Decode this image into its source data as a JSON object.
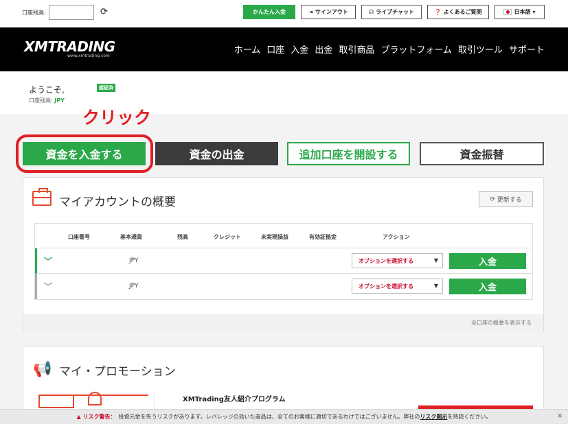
{
  "topbar": {
    "balance_label": "口座残高:",
    "balance_value": "",
    "quick_deposit": "かんたん入金",
    "signout": "サインアウト",
    "livechat": "ライブチャット",
    "faq": "よくあるご質問",
    "language": "日本語"
  },
  "header": {
    "logo": "XMTRADING",
    "logo_sub": "www.xmtrading.com",
    "nav": [
      "ホーム",
      "口座",
      "入金",
      "出金",
      "取引商品",
      "プラットフォーム",
      "取引ツール",
      "サポート"
    ]
  },
  "welcome": {
    "greeting": "ようこそ,",
    "verified_badge": "認証済",
    "balance_label": "口座残高:",
    "balance_currency": "JPY"
  },
  "annotation": {
    "click_label": "クリック",
    "color": "#e01f26"
  },
  "actions": {
    "deposit": "資金を入金する",
    "withdraw": "資金の出金",
    "open_account": "追加口座を開設する",
    "transfer": "資金振替"
  },
  "overview": {
    "title": "マイアカウントの概要",
    "update_button": "更新する",
    "columns": [
      "口座番号",
      "基本通貨",
      "残高",
      "クレジット",
      "未実現損益",
      "有効証拠金",
      "アクション"
    ],
    "rows": [
      {
        "currency": "JPY",
        "option_label": "オプションを選択する",
        "deposit_label": "入金"
      },
      {
        "currency": "JPY",
        "option_label": "オプションを選択する",
        "deposit_label": "入金"
      }
    ],
    "footer_link": "全口座の概要を表示する"
  },
  "promotion": {
    "title": "マイ・プロモーション",
    "program_name": "XMTrading友人紹介プログラム"
  },
  "risk": {
    "warning_label": "リスク警告：",
    "text": "投資元金を失うリスクがあります。レバレッジの効いた商品は、全てのお客様に適切であるわけではございません。弊社の",
    "link": "リスク開示",
    "text_end": "を熟読ください。",
    "close": "✕"
  },
  "colors": {
    "accent_green": "#2aa84a",
    "header_black": "#000000",
    "brand_red": "#e8492d"
  }
}
